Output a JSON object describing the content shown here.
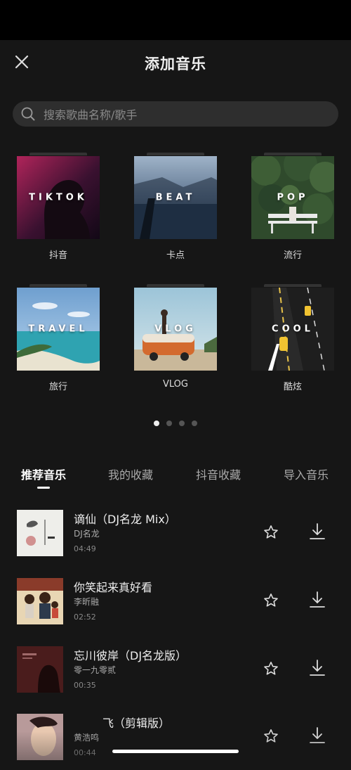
{
  "header": {
    "title": "添加音乐"
  },
  "search": {
    "placeholder": "搜索歌曲名称/歌手"
  },
  "categories": [
    {
      "overlay": "TIKTOK",
      "label": "抖音"
    },
    {
      "overlay": "BEAT",
      "label": "卡点"
    },
    {
      "overlay": "POP",
      "label": "流行"
    },
    {
      "overlay": "TRAVEL",
      "label": "旅行"
    },
    {
      "overlay": "VLOG",
      "label": "VLOG"
    },
    {
      "overlay": "COOL",
      "label": "酷炫"
    }
  ],
  "pagination": {
    "current": 1,
    "total": 4
  },
  "tabs": [
    {
      "label": "推荐音乐",
      "active": true
    },
    {
      "label": "我的收藏",
      "active": false
    },
    {
      "label": "抖音收藏",
      "active": false
    },
    {
      "label": "导入音乐",
      "active": false
    }
  ],
  "songs": [
    {
      "title": "谪仙（DJ名龙 Mix）",
      "artist": "DJ名龙",
      "duration": "04:49"
    },
    {
      "title": "你笑起来真好看",
      "artist": "李昕融",
      "duration": "02:52"
    },
    {
      "title": "忘川彼岸（DJ名龙版）",
      "artist": "零一九零贰",
      "duration": "00:35"
    },
    {
      "title": "飞（剪辑版）",
      "artist": "黄浩鸣",
      "duration": "00:44"
    }
  ],
  "icons": {
    "close": "close-icon",
    "search": "search-icon",
    "favorite": "star-icon",
    "download": "download-icon"
  }
}
